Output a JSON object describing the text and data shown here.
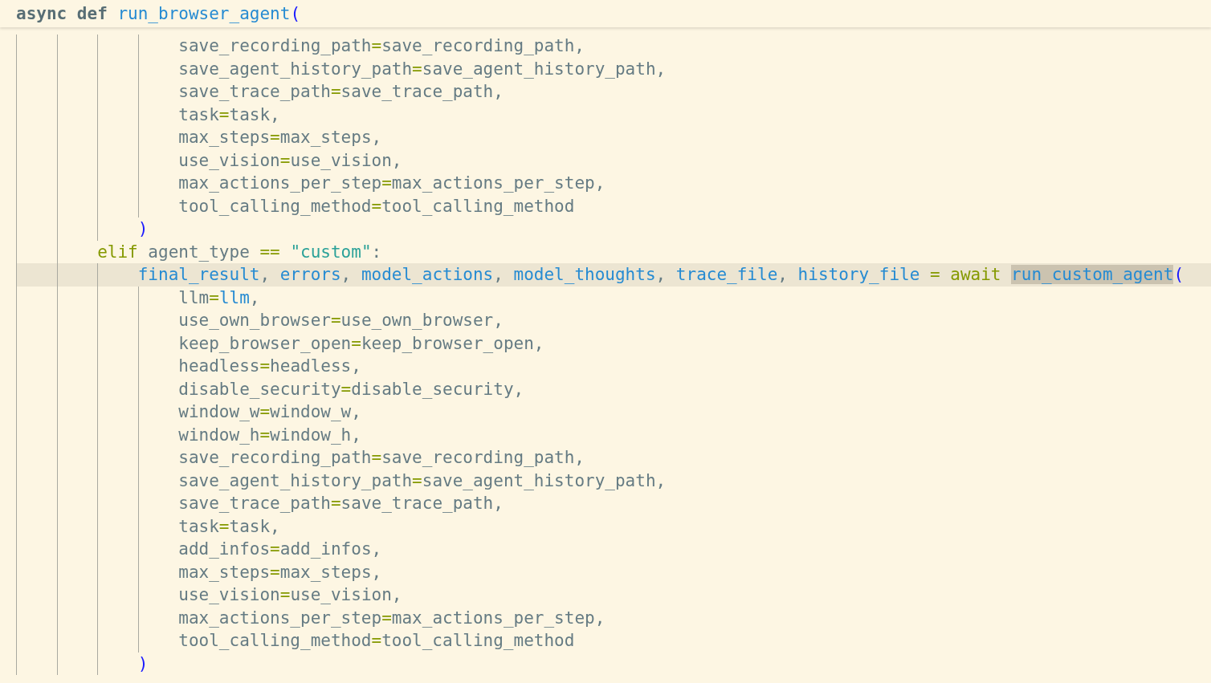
{
  "sticky_header": {
    "tokens": [
      {
        "kind": "declaration",
        "text": "async def "
      },
      {
        "kind": "name",
        "text": "run_browser_agent"
      },
      {
        "kind": "bracket",
        "text": "("
      }
    ]
  },
  "lines": [
    {
      "children": [
        {
          "children": [
            {
              "current": false,
              "tokens": [
                {
                  "kind": "text",
                  "text": "save_recording_path"
                },
                {
                  "kind": "operator",
                  "text": "="
                },
                {
                  "kind": "text",
                  "text": "save_recording_path,"
                }
              ]
            },
            {
              "current": false,
              "tokens": [
                {
                  "kind": "text",
                  "text": "save_agent_history_path"
                },
                {
                  "kind": "operator",
                  "text": "="
                },
                {
                  "kind": "text",
                  "text": "save_agent_history_path,"
                }
              ]
            },
            {
              "current": false,
              "tokens": [
                {
                  "kind": "text",
                  "text": "save_trace_path"
                },
                {
                  "kind": "operator",
                  "text": "="
                },
                {
                  "kind": "text",
                  "text": "save_trace_path,"
                }
              ]
            },
            {
              "current": false,
              "tokens": [
                {
                  "kind": "text",
                  "text": "task"
                },
                {
                  "kind": "operator",
                  "text": "="
                },
                {
                  "kind": "text",
                  "text": "task,"
                }
              ]
            },
            {
              "current": false,
              "tokens": [
                {
                  "kind": "text",
                  "text": "max_steps"
                },
                {
                  "kind": "operator",
                  "text": "="
                },
                {
                  "kind": "text",
                  "text": "max_steps,"
                }
              ]
            },
            {
              "current": false,
              "tokens": [
                {
                  "kind": "text",
                  "text": "use_vision"
                },
                {
                  "kind": "operator",
                  "text": "="
                },
                {
                  "kind": "text",
                  "text": "use_vision,"
                }
              ]
            },
            {
              "current": false,
              "tokens": [
                {
                  "kind": "text",
                  "text": "max_actions_per_step"
                },
                {
                  "kind": "operator",
                  "text": "="
                },
                {
                  "kind": "text",
                  "text": "max_actions_per_step,"
                }
              ]
            },
            {
              "current": false,
              "tokens": [
                {
                  "kind": "text",
                  "text": "tool_calling_method"
                },
                {
                  "kind": "operator",
                  "text": "="
                },
                {
                  "kind": "text",
                  "text": "tool_calling_method"
                }
              ]
            }
          ]
        },
        {
          "current": false,
          "tokens": [
            {
              "kind": "bracket",
              "text": ")"
            }
          ]
        }
      ]
    },
    {
      "current": false,
      "tokens": [
        {
          "kind": "keyword",
          "text": "elif"
        },
        {
          "kind": "text",
          "text": " agent_type "
        },
        {
          "kind": "operator",
          "text": "=="
        },
        {
          "kind": "string",
          "text": " \"custom\""
        },
        {
          "kind": "text",
          "text": ":"
        }
      ],
      "children": [
        {
          "current": true,
          "tokens": [
            {
              "kind": "name",
              "text": "final_result"
            },
            {
              "kind": "text",
              "text": ", "
            },
            {
              "kind": "name",
              "text": "errors"
            },
            {
              "kind": "text",
              "text": ", "
            },
            {
              "kind": "name",
              "text": "model_actions"
            },
            {
              "kind": "text",
              "text": ", "
            },
            {
              "kind": "name",
              "text": "model_thoughts"
            },
            {
              "kind": "text",
              "text": ", "
            },
            {
              "kind": "name",
              "text": "trace_file"
            },
            {
              "kind": "text",
              "text": ", "
            },
            {
              "kind": "name",
              "text": "history_file"
            },
            {
              "kind": "operator",
              "text": " = "
            },
            {
              "kind": "keyword",
              "text": "await "
            },
            {
              "kind": "name",
              "text": "run_custom_agent",
              "highlighted": true
            },
            {
              "kind": "bracket",
              "text": "("
            }
          ],
          "children": [
            {
              "current": false,
              "tokens": [
                {
                  "kind": "text",
                  "text": "llm"
                },
                {
                  "kind": "operator",
                  "text": "="
                },
                {
                  "kind": "name",
                  "text": "llm"
                },
                {
                  "kind": "text",
                  "text": ","
                }
              ]
            },
            {
              "current": false,
              "tokens": [
                {
                  "kind": "text",
                  "text": "use_own_browser"
                },
                {
                  "kind": "operator",
                  "text": "="
                },
                {
                  "kind": "text",
                  "text": "use_own_browser,"
                }
              ]
            },
            {
              "current": false,
              "tokens": [
                {
                  "kind": "text",
                  "text": "keep_browser_open"
                },
                {
                  "kind": "operator",
                  "text": "="
                },
                {
                  "kind": "text",
                  "text": "keep_browser_open,"
                }
              ]
            },
            {
              "current": false,
              "tokens": [
                {
                  "kind": "text",
                  "text": "headless"
                },
                {
                  "kind": "operator",
                  "text": "="
                },
                {
                  "kind": "text",
                  "text": "headless,"
                }
              ]
            },
            {
              "current": false,
              "tokens": [
                {
                  "kind": "text",
                  "text": "disable_security"
                },
                {
                  "kind": "operator",
                  "text": "="
                },
                {
                  "kind": "text",
                  "text": "disable_security,"
                }
              ]
            },
            {
              "current": false,
              "tokens": [
                {
                  "kind": "text",
                  "text": "window_w"
                },
                {
                  "kind": "operator",
                  "text": "="
                },
                {
                  "kind": "text",
                  "text": "window_w,"
                }
              ]
            },
            {
              "current": false,
              "tokens": [
                {
                  "kind": "text",
                  "text": "window_h"
                },
                {
                  "kind": "operator",
                  "text": "="
                },
                {
                  "kind": "text",
                  "text": "window_h,"
                }
              ]
            },
            {
              "current": false,
              "tokens": [
                {
                  "kind": "text",
                  "text": "save_recording_path"
                },
                {
                  "kind": "operator",
                  "text": "="
                },
                {
                  "kind": "text",
                  "text": "save_recording_path,"
                }
              ]
            },
            {
              "current": false,
              "tokens": [
                {
                  "kind": "text",
                  "text": "save_agent_history_path"
                },
                {
                  "kind": "operator",
                  "text": "="
                },
                {
                  "kind": "text",
                  "text": "save_agent_history_path,"
                }
              ]
            },
            {
              "current": false,
              "tokens": [
                {
                  "kind": "text",
                  "text": "save_trace_path"
                },
                {
                  "kind": "operator",
                  "text": "="
                },
                {
                  "kind": "text",
                  "text": "save_trace_path,"
                }
              ]
            },
            {
              "current": false,
              "tokens": [
                {
                  "kind": "text",
                  "text": "task"
                },
                {
                  "kind": "operator",
                  "text": "="
                },
                {
                  "kind": "text",
                  "text": "task,"
                }
              ]
            },
            {
              "current": false,
              "tokens": [
                {
                  "kind": "text",
                  "text": "add_infos"
                },
                {
                  "kind": "operator",
                  "text": "="
                },
                {
                  "kind": "text",
                  "text": "add_infos,"
                }
              ]
            },
            {
              "current": false,
              "tokens": [
                {
                  "kind": "text",
                  "text": "max_steps"
                },
                {
                  "kind": "operator",
                  "text": "="
                },
                {
                  "kind": "text",
                  "text": "max_steps,"
                }
              ]
            },
            {
              "current": false,
              "tokens": [
                {
                  "kind": "text",
                  "text": "use_vision"
                },
                {
                  "kind": "operator",
                  "text": "="
                },
                {
                  "kind": "text",
                  "text": "use_vision,"
                }
              ]
            },
            {
              "current": false,
              "tokens": [
                {
                  "kind": "text",
                  "text": "max_actions_per_step"
                },
                {
                  "kind": "operator",
                  "text": "="
                },
                {
                  "kind": "text",
                  "text": "max_actions_per_step,"
                }
              ]
            },
            {
              "current": false,
              "tokens": [
                {
                  "kind": "text",
                  "text": "tool_calling_method"
                },
                {
                  "kind": "operator",
                  "text": "="
                },
                {
                  "kind": "text",
                  "text": "tool_calling_method"
                }
              ]
            }
          ]
        },
        {
          "current": false,
          "tokens": [
            {
              "kind": "bracket",
              "text": ")"
            }
          ]
        }
      ]
    }
  ]
}
